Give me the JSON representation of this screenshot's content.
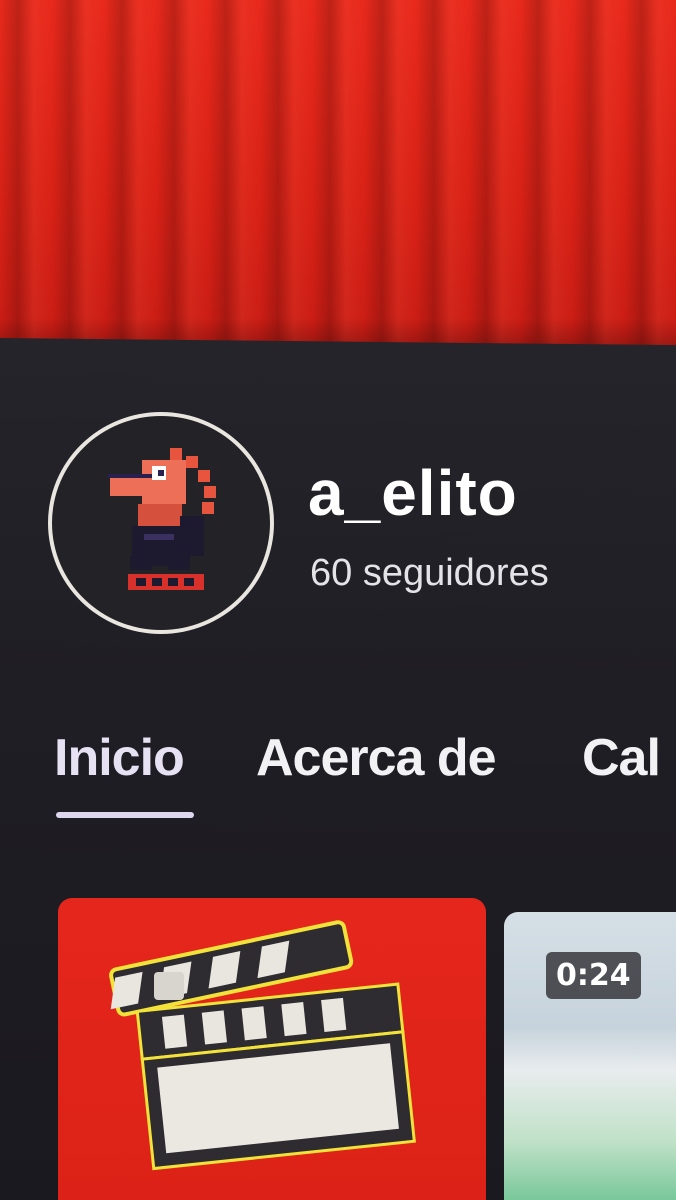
{
  "banner": {
    "color": "#e0261a"
  },
  "channel": {
    "name": "a_elito",
    "followers": "60 seguidores",
    "avatar_icon": "pixel-dino-avatar"
  },
  "tabs": [
    {
      "label": "Inicio",
      "active": true
    },
    {
      "label": "Acerca de",
      "active": false
    },
    {
      "label": "Cal",
      "active": false
    }
  ],
  "videos": [
    {
      "thumbnail_icon": "clapperboard-icon",
      "accent": "#e5261c"
    },
    {
      "duration": "0:24"
    }
  ]
}
